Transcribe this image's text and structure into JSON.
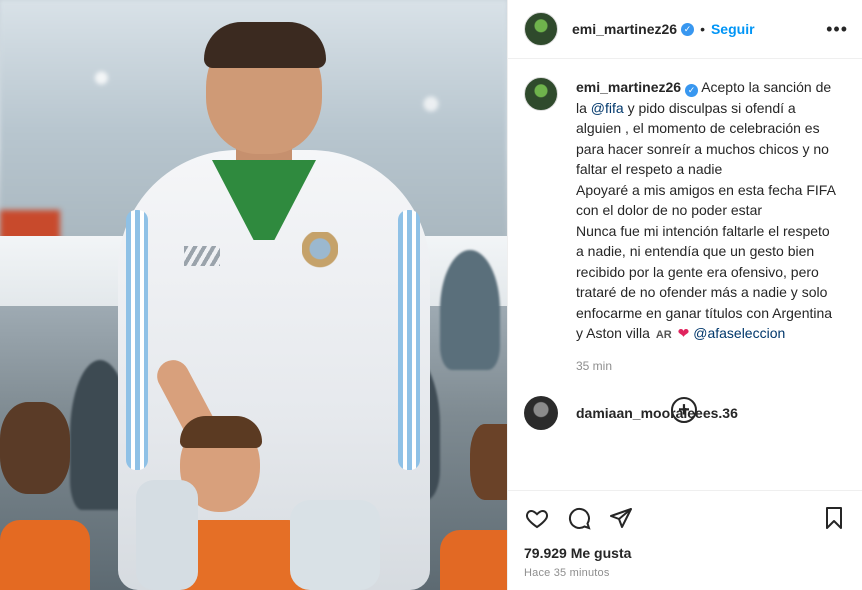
{
  "post": {
    "username": "emi_martinez26",
    "follow_label": "Seguir",
    "more_label": "•••",
    "caption": {
      "username": "emi_martinez26",
      "text_before_mention": "Acepto la sanción de la ",
      "mention1": "@fifa",
      "text_after_mention": " y pido disculpas si ofendí a alguien , el momento de celebración es para hacer sonreír a muchos chicos y no faltar el respeto a nadie\nApoyaré a mis amigos en esta fecha FIFA con el dolor de no poder estar\nNunca fue mi intención faltarle el respeto a nadie, ni entendía que un gesto bien recibido por la gente era ofensivo, pero trataré de no ofender más a nadie y solo enfocarme en ganar títulos con Argentina y Aston villa ",
      "flag": "AR",
      "heart": "❤",
      "mention2": "@afaseleccion",
      "time": "35 min"
    },
    "add_label": "+",
    "comment": {
      "username": "damiaan_mooraleees.36"
    },
    "likes": "79.929 Me gusta",
    "time_ago": "Hace 35 minutos"
  },
  "icons": {
    "verified": "verified-badge-icon",
    "like": "heart-icon",
    "comment": "comment-icon",
    "share": "share-icon",
    "save": "bookmark-icon",
    "add": "plus-circle-icon"
  },
  "colors": {
    "link_blue": "#0095f6",
    "mention_blue": "#00376b",
    "heart_red": "#e0245e",
    "verified_blue": "#3897f0"
  }
}
